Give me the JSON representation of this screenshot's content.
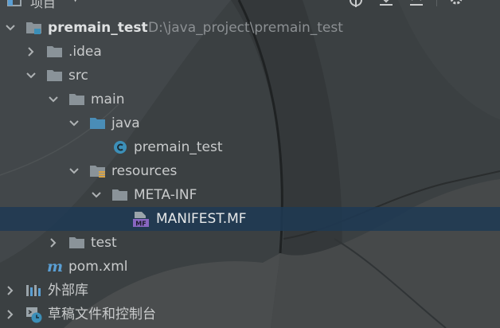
{
  "topbar": {
    "title": "项目",
    "caret": "▼",
    "icons": [
      "target-icon",
      "collapse-all-icon",
      "expand-icon",
      "gear-icon"
    ]
  },
  "tree": [
    {
      "name": "tree-row-premain-test",
      "label": "premain_test",
      "path": "D:\\java_project\\premain_test",
      "icon": "module-folder-icon",
      "expanded": true,
      "bold": true
    },
    {
      "name": "tree-row-idea",
      "label": ".idea",
      "icon": "folder-icon",
      "expanded": false
    },
    {
      "name": "tree-row-src",
      "label": "src",
      "icon": "folder-icon",
      "expanded": true
    },
    {
      "name": "tree-row-main",
      "label": "main",
      "icon": "folder-icon",
      "expanded": true
    },
    {
      "name": "tree-row-java",
      "label": "java",
      "icon": "source-folder-icon",
      "expanded": true
    },
    {
      "name": "tree-row-premain-class",
      "label": "premain_test",
      "icon": "java-class-icon"
    },
    {
      "name": "tree-row-resources",
      "label": "resources",
      "icon": "resources-folder-icon",
      "expanded": true
    },
    {
      "name": "tree-row-meta-inf",
      "label": "META-INF",
      "icon": "folder-icon",
      "expanded": true
    },
    {
      "name": "tree-row-manifest",
      "label": "MANIFEST.MF",
      "icon": "manifest-file-icon",
      "selected": true,
      "icon_text": "MF"
    },
    {
      "name": "tree-row-test",
      "label": "test",
      "icon": "folder-icon",
      "expanded": false
    },
    {
      "name": "tree-row-pom",
      "label": "pom.xml",
      "icon": "maven-icon",
      "icon_text": "m"
    },
    {
      "name": "tree-row-external-libraries",
      "label": "外部库",
      "icon": "library-icon",
      "expanded": false
    },
    {
      "name": "tree-row-scratches",
      "label": "草稿文件和控制台",
      "icon": "scratches-icon",
      "expanded": false
    }
  ],
  "colors": {
    "background": "#3b4042",
    "selection": "#1e3a54",
    "folder": "#8a9399",
    "source_folder": "#4a8db7",
    "class_icon": "#3c8fb8",
    "maven": "#5a9fd4",
    "manifest": "#8866c0"
  }
}
